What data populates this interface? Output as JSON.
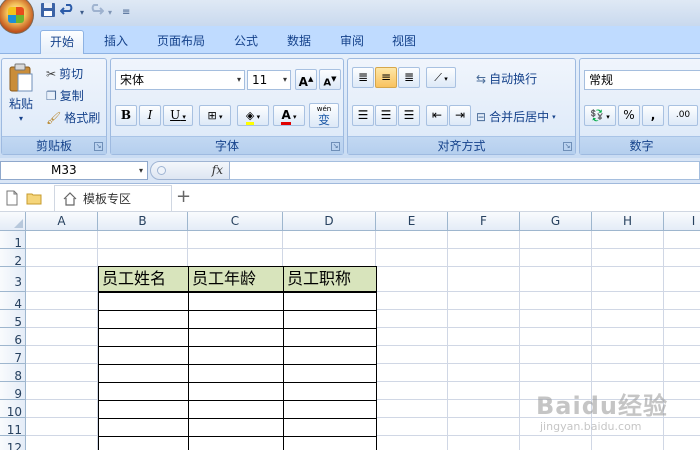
{
  "quick_access": {
    "save_icon": "save-icon",
    "undo_icon": "undo-icon",
    "redo_icon": "redo-icon",
    "customize_icon": "customize-icon"
  },
  "tabs": [
    {
      "label": "开始",
      "active": true
    },
    {
      "label": "插入",
      "active": false
    },
    {
      "label": "页面布局",
      "active": false
    },
    {
      "label": "公式",
      "active": false
    },
    {
      "label": "数据",
      "active": false
    },
    {
      "label": "审阅",
      "active": false
    },
    {
      "label": "视图",
      "active": false
    }
  ],
  "clipboard": {
    "paste": "粘贴",
    "cut": "剪切",
    "copy": "复制",
    "format_painter": "格式刷",
    "group_label": "剪贴板"
  },
  "font": {
    "name": "宋体",
    "size": "11",
    "grow_label": "A",
    "shrink_label": "A",
    "bold": "B",
    "italic": "I",
    "underline": "U",
    "font_color_label": "A",
    "phonetic_label": "wén",
    "phonetic_char": "变",
    "group_label": "字体"
  },
  "alignment": {
    "wrap_text": "自动换行",
    "merge_center": "合并后居中",
    "group_label": "对齐方式"
  },
  "number": {
    "format": "常规",
    "percent": "%",
    "comma": ",",
    "inc_decimal": ".00",
    "group_label": "数字"
  },
  "formula_bar": {
    "name_box": "M33",
    "fx": "fx",
    "formula": ""
  },
  "doc_tabs": {
    "template_tab": "模板专区",
    "plus": "+"
  },
  "columns": [
    "A",
    "B",
    "C",
    "D",
    "E",
    "F",
    "G",
    "H",
    "I"
  ],
  "rows": [
    "1",
    "2",
    "3",
    "4",
    "5",
    "6",
    "7",
    "8",
    "9",
    "10",
    "11",
    "12"
  ],
  "table": {
    "headers": [
      "员工姓名",
      "员工年龄",
      "员工职称"
    ],
    "header_bg": "#d8e4bc"
  },
  "watermark": {
    "main": "Baidu经验",
    "sub": "jingyan.baidu.com"
  },
  "colors": {
    "ribbon_tab_bg": "#bfdbff",
    "accent": "#15428b",
    "highlight": "#f9c25e"
  }
}
